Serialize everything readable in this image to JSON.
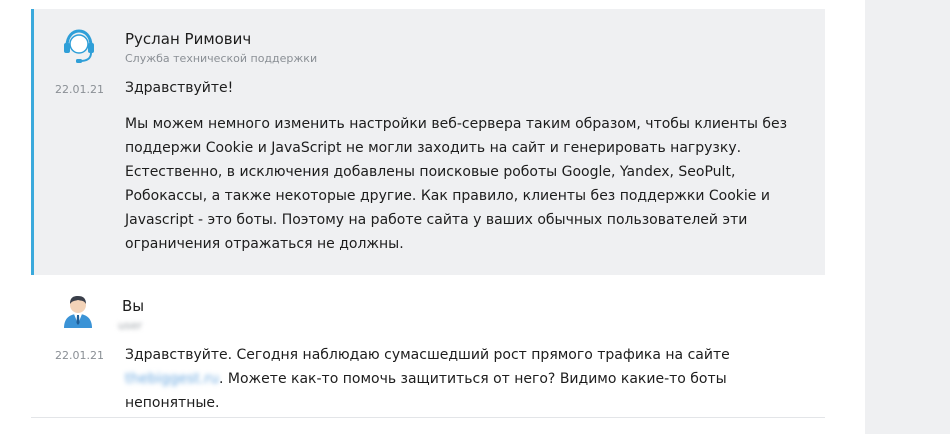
{
  "messages": [
    {
      "author": "Руслан Римович",
      "role": "Служба технической поддержки",
      "date": "22.01.21",
      "paragraphs": [
        "Здравствуйте!",
        "Мы можем немного изменить настройки веб-сервера таким образом, чтобы клиенты без поддержи Cookie и JavaScript не могли заходить на сайт и генерировать нагрузку. Естественно, в исключения добавлены поисковые роботы Google, Yandex, SeoPult, Робокассы, а также некоторые другие. Как правило, клиенты без поддержки Cookie и Javascript - это боты. Поэтому на работе сайта у ваших обычных пользователей эти ограничения отражаться не должны."
      ],
      "avatar_icon": "headset-support-icon",
      "accent_color": "#3aa9dc"
    },
    {
      "author": "Вы",
      "role": "user",
      "date": "22.01.21",
      "text_before_link": "Здравствуйте. Сегодня наблюдаю сумасшедший рост прямого трафика на сайте ",
      "link_text": "thebiggest.ru",
      "text_after_link": ". Можете как-то помочь защититься от него? Видимо какие-то боты непонятные.",
      "avatar_icon": "user-businessman-icon"
    }
  ]
}
